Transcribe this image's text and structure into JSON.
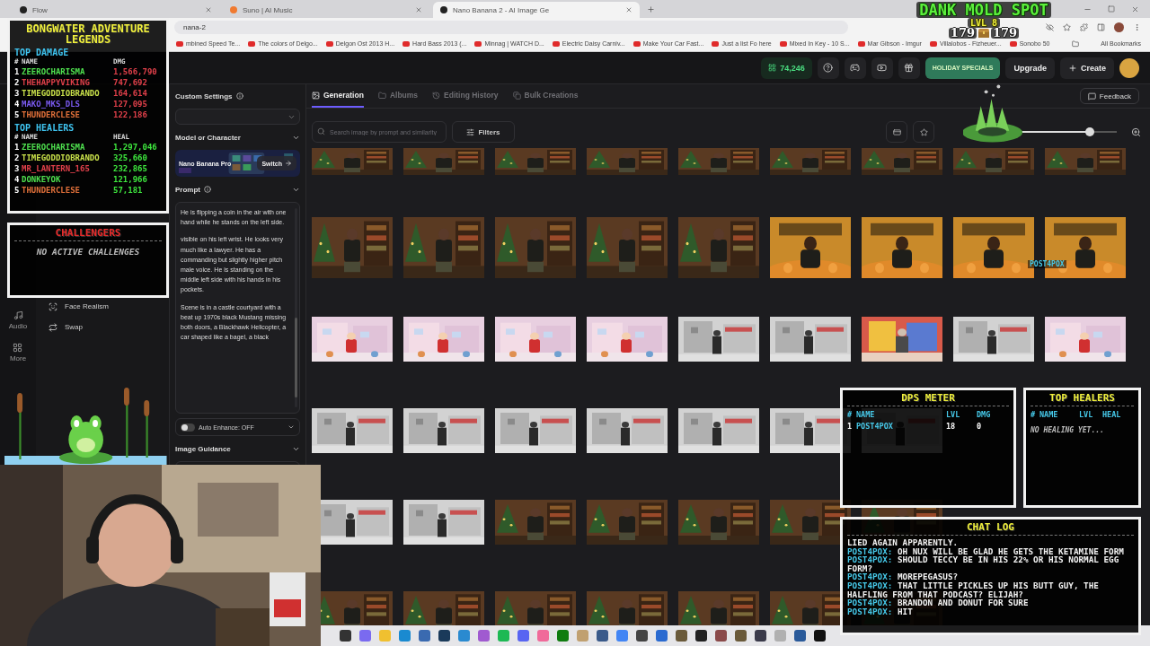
{
  "browser": {
    "tabs": [
      {
        "title": "Flow",
        "selected": false
      },
      {
        "title": "Suno | AI Music",
        "selected": false
      },
      {
        "title": "Nano Banana 2 - AI Image Ge",
        "selected": true
      }
    ],
    "address": "nana-2",
    "bookmarks": [
      "mbined Speed Te...",
      "The colors of Delgo...",
      "Delgon Ost 2013 H...",
      "Hard Bass 2013 (...",
      "Minnag | WATCH D...",
      "Electric Daisy Carniv...",
      "Make Your Car Fast...",
      "Just a list Fo here",
      "Mixed In Key - 10 S...",
      "Mar Gibson - Imgur",
      "Villalobos - Fizheuer...",
      "Sonobo 50"
    ],
    "all_bookmarks": "All Bookmarks"
  },
  "header": {
    "credits": "74,246",
    "holiday": "HOLIDAY SPECIALS",
    "upgrade": "Upgrade",
    "create": "Create"
  },
  "nav": [
    {
      "label": "Audio"
    },
    {
      "label": "More"
    }
  ],
  "menu": [
    {
      "label": "Face Realism"
    },
    {
      "label": "Swap"
    }
  ],
  "settings": {
    "custom_title": "Custom Settings",
    "model_title": "Model or Character",
    "model_name": "Nano Banana Pro",
    "switch": "Switch",
    "prompt_title": "Prompt",
    "prompt": [
      "He is flipping a coin in the air with one hand while he stands on the left side.",
      "visible on his left wrist. He looks very much like a lawyer. He has a commanding but slightly higher pitch male voice. He is standing on the middle left side with his hands in his pockets.",
      "Scene is in a castle courtyard with a beat up 1970s black Mustang missing both doors, a Blackhawk Helicopter, a car shaped like a bagel, a black"
    ],
    "auto_enhance": {
      "label": "Auto Enhance: OFF",
      "on": false
    },
    "guidance_title": "Image Guidance"
  },
  "main": {
    "tabs": [
      {
        "label": "Generation",
        "selected": true
      },
      {
        "label": "Albums",
        "selected": false
      },
      {
        "label": "Editing History",
        "selected": false
      },
      {
        "label": "Bulk Creations",
        "selected": false
      }
    ],
    "feedback": "Feedback",
    "search": {
      "placeholder": "Search image by prompt and similarity"
    },
    "filters": "Filters",
    "size_slider": {
      "level": 0.72
    }
  },
  "overlay": {
    "title": "BONGWATER ADVENTURE LEGENDS",
    "top_damage": {
      "title": "TOP DAMAGE",
      "columns": [
        "#",
        "NAME",
        "DMG"
      ],
      "rows": [
        {
          "rank": "1",
          "name": "ZEEROCHARISMA",
          "value": "1,566,790",
          "color": "#4fe04f"
        },
        {
          "rank": "2",
          "name": "THEHAPPYVIKING",
          "value": "747,692",
          "color": "#e0404a"
        },
        {
          "rank": "3",
          "name": "TIMEGODDIOBRANDO",
          "value": "164,614",
          "color": "#c8e04a"
        },
        {
          "rank": "4",
          "name": "MAKO_MKS_DLS",
          "value": "127,095",
          "color": "#7a5af0"
        },
        {
          "rank": "5",
          "name": "THUNDERCLESE",
          "value": "122,186",
          "color": "#e0703a"
        }
      ]
    },
    "top_healers": {
      "title": "TOP HEALERS",
      "columns": [
        "#",
        "NAME",
        "HEAL"
      ],
      "rows": [
        {
          "rank": "1",
          "name": "ZEEROCHARISMA",
          "value": "1,297,046",
          "color": "#4fe04f"
        },
        {
          "rank": "2",
          "name": "TIMEGODDIOBRANDO",
          "value": "325,660",
          "color": "#c8e04a"
        },
        {
          "rank": "3",
          "name": "MR_LANTERN_165",
          "value": "232,865",
          "color": "#e0404a"
        },
        {
          "rank": "4",
          "name": "DONKEYOK",
          "value": "121,966",
          "color": "#4fe04f"
        },
        {
          "rank": "5",
          "name": "THUNDERCLESE",
          "value": "57,181",
          "color": "#e0703a"
        }
      ]
    },
    "challengers": {
      "title": "CHALLENGERS",
      "empty": "NO ACTIVE CHALLENGES"
    },
    "spot": {
      "title": "DANK MOLD SPOT",
      "level": "LVL 8",
      "hp": "179",
      "max_hp": "179"
    },
    "player_name": "POST4POX",
    "dps": {
      "title": "DPS METER",
      "columns": [
        "#",
        "NAME",
        "LVL",
        "DMG"
      ],
      "rows": [
        {
          "rank": "1",
          "name": "POST4POX",
          "lvl": "18",
          "dmg": "0"
        }
      ]
    },
    "healers": {
      "title": "TOP HEALERS",
      "columns": [
        "#",
        "NAME",
        "LVL",
        "HEAL"
      ],
      "empty": "NO HEALING YET..."
    },
    "chat": {
      "title": "CHAT LOG",
      "messages": [
        {
          "text": "LIED AGAIN APPARENTLY."
        },
        {
          "user": "POST4POX:",
          "text": "OH NUX WILL BE GLAD HE GETS THE KETAMINE FORM"
        },
        {
          "user": "POST4POX:",
          "text": "SHOULD TECCY BE IN HIS 22% OR HIS NORMAL EGG FORM?"
        },
        {
          "user": "POST4POX:",
          "text": "MOREPEGASUS?"
        },
        {
          "user": "POST4POX:",
          "text": "THAT LITTLE PICKLES UP HIS BUTT GUY, THE HALFLING FROM THAT PODCAST? ELIJAH?"
        },
        {
          "user": "POST4POX:",
          "text": "BRANDON AND DONUT FOR SURE"
        },
        {
          "user": "POST4POX:",
          "text": "HIT"
        }
      ]
    }
  }
}
